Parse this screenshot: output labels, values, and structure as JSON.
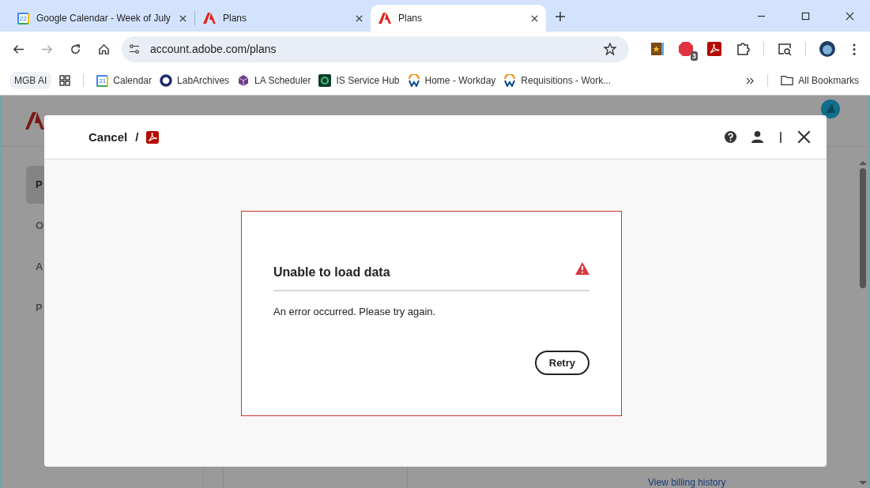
{
  "browser": {
    "tabs": [
      {
        "title": "Google Calendar - Week of July",
        "kind": "calendar",
        "icon_text": "22",
        "selected": false
      },
      {
        "title": "Plans",
        "kind": "adobe",
        "selected": false
      },
      {
        "title": "Plans",
        "kind": "adobe",
        "selected": true
      }
    ],
    "address": "account.adobe.com/plans",
    "extension_badge": "3",
    "bookmarks": [
      {
        "label": "MGB AI",
        "kind": "chip"
      },
      {
        "kind": "apps"
      },
      {
        "label": "Calendar",
        "kind": "calendar",
        "icon_text": "21"
      },
      {
        "label": "LabArchives",
        "kind": "ring"
      },
      {
        "label": "LA Scheduler",
        "kind": "cube"
      },
      {
        "label": "IS Service Hub",
        "kind": "hub"
      },
      {
        "label": "Home - Workday",
        "kind": "workday"
      },
      {
        "label": "Requisitions - Work...",
        "kind": "workday"
      }
    ],
    "all_bookmarks": "All Bookmarks"
  },
  "background_page": {
    "sidebar": [
      {
        "label": "P",
        "selected": true
      },
      {
        "label": "O",
        "selected": false
      },
      {
        "label": "A",
        "selected": false
      },
      {
        "label": "P",
        "selected": false
      }
    ],
    "link": "View billing history"
  },
  "dialog": {
    "breadcrumb": "Cancel",
    "separator": "/",
    "error": {
      "title": "Unable to load data",
      "message": "An error occurred. Please try again.",
      "button": "Retry"
    }
  }
}
